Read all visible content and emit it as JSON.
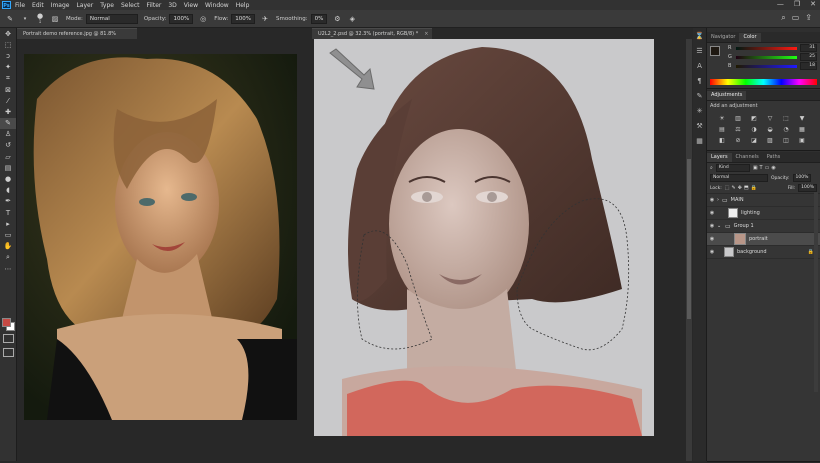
{
  "app": {
    "logo": "Ps"
  },
  "menu": [
    "File",
    "Edit",
    "Image",
    "Layer",
    "Type",
    "Select",
    "Filter",
    "3D",
    "View",
    "Window",
    "Help"
  ],
  "window_controls": [
    "—",
    "❐",
    "✕"
  ],
  "options_bar": {
    "mode_label": "Mode:",
    "mode_value": "Normal",
    "opacity_label": "Opacity:",
    "opacity_value": "100%",
    "flow_label": "Flow:",
    "flow_value": "100%",
    "smoothing_label": "Smoothing:",
    "smoothing_value": "0%",
    "brush_size": "1"
  },
  "documents": [
    {
      "tab": "Portrait demo reference.jpg @ 81.8% (RGB/8#)",
      "close": "×"
    },
    {
      "tab": "U2L2_2.psd @ 32.3% (portrait, RGB/8) *",
      "close": "×"
    }
  ],
  "color_panel": {
    "tabs": [
      "Navigator",
      "Color"
    ],
    "active_tab": "Color",
    "r": "31",
    "g": "25",
    "b": "18",
    "r_label": "R",
    "g_label": "G",
    "b_label": "B"
  },
  "adjustments_panel": {
    "tab": "Adjustments",
    "hint": "Add an adjustment",
    "icons": [
      "☀",
      "▥",
      "◩",
      "▽",
      "⬚",
      "▼",
      "▤",
      "⚖",
      "◑",
      "◒",
      "◔",
      "▦",
      "◧",
      "⊘",
      "◪",
      "▨",
      "◫",
      "▣"
    ]
  },
  "layers_panel": {
    "tabs": [
      "Layers",
      "Channels",
      "Paths"
    ],
    "active_tab": "Layers",
    "filter_label": "Kind",
    "blend_mode": "Normal",
    "opacity_label": "Opacity:",
    "opacity_value": "100%",
    "lock_label": "Lock:",
    "fill_label": "Fill:",
    "fill_value": "100%",
    "layers": [
      {
        "name": "MAIN",
        "type": "group"
      },
      {
        "name": "lighting",
        "type": "layer"
      },
      {
        "name": "Group 1",
        "type": "group"
      },
      {
        "name": "portrait",
        "type": "layer"
      },
      {
        "name": "background",
        "type": "layer"
      }
    ]
  },
  "colors": {
    "foreground": "#c64a44",
    "background": "#ffffff",
    "accent": "#31a8ff"
  }
}
